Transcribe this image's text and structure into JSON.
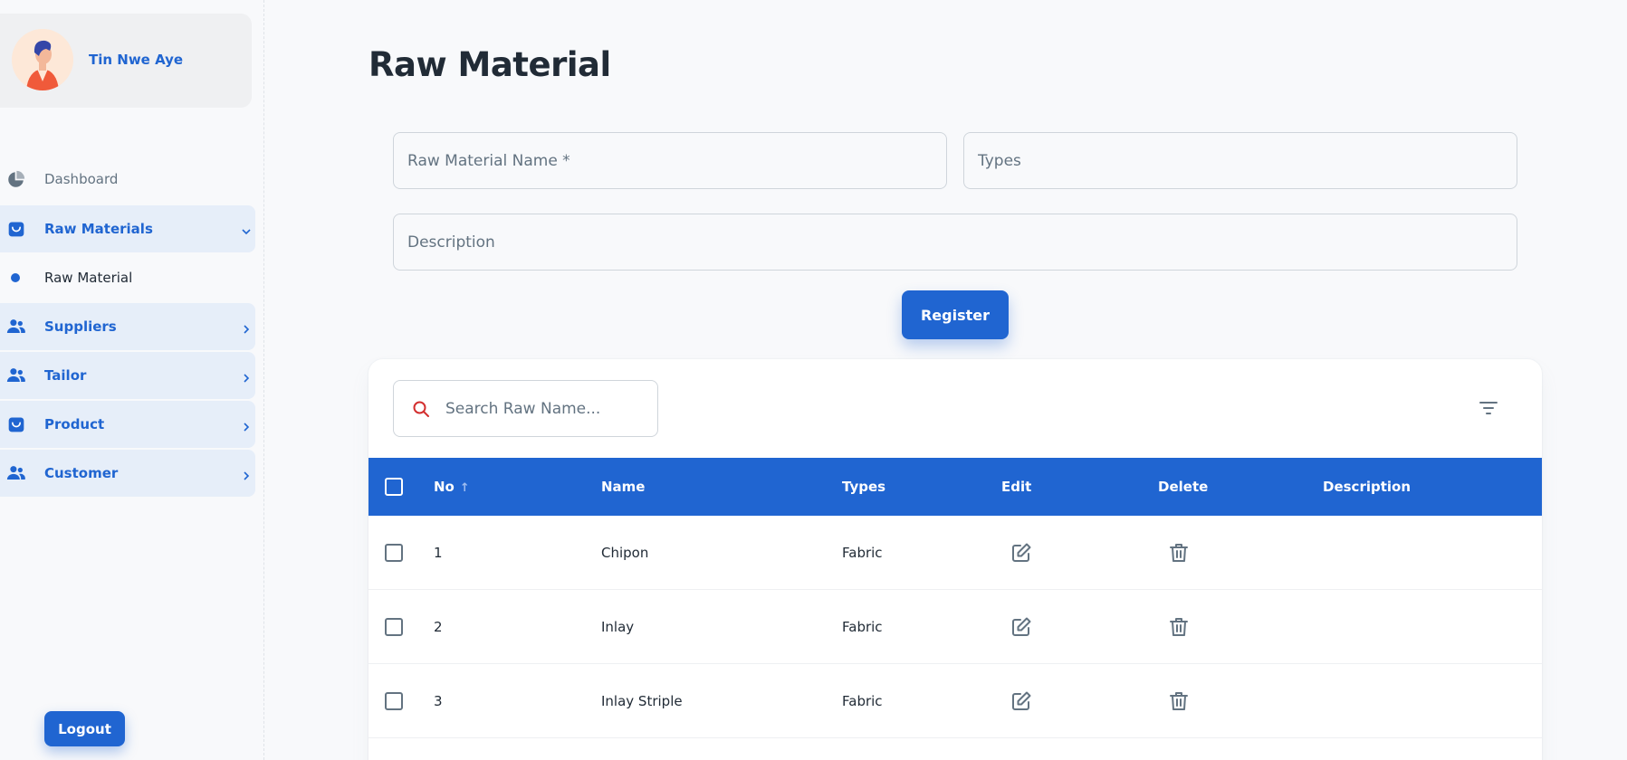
{
  "user": {
    "name": "Tin Nwe Aye"
  },
  "nav": {
    "dashboard": "Dashboard",
    "raw_materials": "Raw Materials",
    "raw_material": "Raw Material",
    "suppliers": "Suppliers",
    "tailor": "Tailor",
    "product": "Product",
    "customer": "Customer",
    "logout": "Logout"
  },
  "page": {
    "title": "Raw Material"
  },
  "form": {
    "name_placeholder": "Raw Material Name *",
    "types_placeholder": "Types",
    "description_placeholder": "Description",
    "register_label": "Register"
  },
  "table": {
    "search_placeholder": "Search Raw Name...",
    "columns": {
      "no": "No",
      "name": "Name",
      "types": "Types",
      "edit": "Edit",
      "delete": "Delete",
      "description": "Description"
    },
    "sort_indicator": "↑",
    "rows": [
      {
        "no": "1",
        "name": "Chipon",
        "types": "Fabric",
        "description": ""
      },
      {
        "no": "2",
        "name": "Inlay",
        "types": "Fabric",
        "description": ""
      },
      {
        "no": "3",
        "name": "Inlay Striple",
        "types": "Fabric",
        "description": ""
      }
    ]
  },
  "icons": {
    "dashboard": "pie-chart-icon",
    "raw_materials": "shopping-bag-icon",
    "suppliers": "people-icon",
    "tailor": "people-icon",
    "product": "shopping-bag-icon",
    "customer": "people-icon",
    "search": "search-icon",
    "filter": "filter-list-icon",
    "edit": "edit-icon",
    "delete": "trash-icon"
  },
  "colors": {
    "primary": "#2065d1",
    "search_icon": "#d32f2f",
    "text": "#212b36",
    "muted": "#637381"
  }
}
